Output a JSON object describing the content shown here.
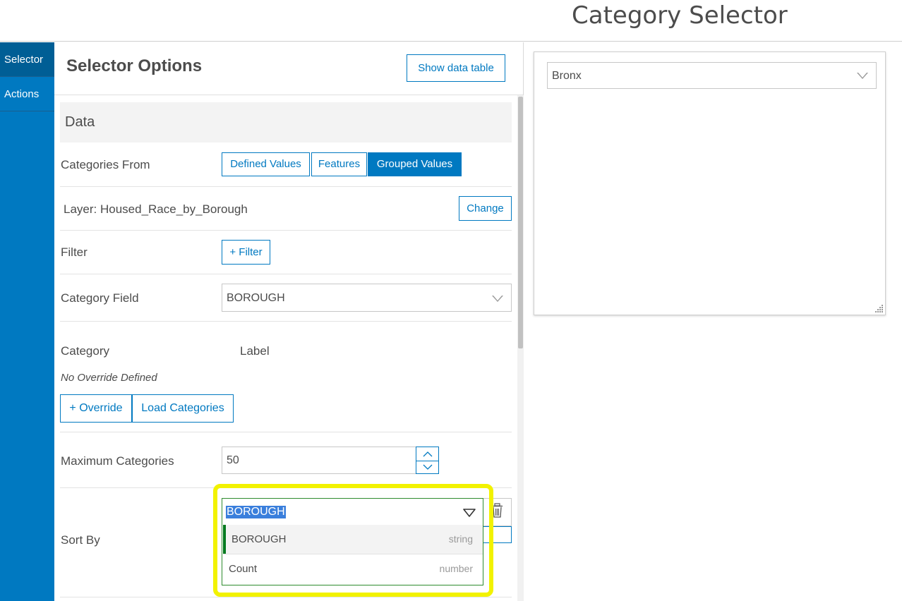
{
  "header": {
    "title": "Category Selector"
  },
  "rail": {
    "tabs": [
      {
        "label": "Selector"
      },
      {
        "label": "Actions"
      }
    ]
  },
  "panel": {
    "title": "Selector Options",
    "show_table_label": "Show data table",
    "data_section": {
      "title": "Data"
    },
    "categories_from": {
      "label": "Categories From",
      "options": [
        "Defined Values",
        "Features",
        "Grouped Values"
      ],
      "selected": "Grouped Values"
    },
    "layer": {
      "label": "Layer: Housed_Race_by_Borough",
      "change_label": "Change"
    },
    "filter": {
      "label": "Filter",
      "button_label": "+ Filter"
    },
    "category_field": {
      "label": "Category Field",
      "value": "BOROUGH"
    },
    "override": {
      "category_header": "Category",
      "label_header": "Label",
      "empty_text": "No Override Defined",
      "add_label": "+ Override",
      "load_label": "Load Categories"
    },
    "max_categories": {
      "label": "Maximum Categories",
      "value": "50"
    },
    "sort_by": {
      "label": "Sort By",
      "value": "BOROUGH",
      "options": [
        {
          "name": "BOROUGH",
          "type": "string"
        },
        {
          "name": "Count",
          "type": "number"
        }
      ]
    }
  },
  "preview": {
    "selected": "Bronx"
  },
  "colors": {
    "accent": "#0079c1",
    "highlight": "#f2f200",
    "active_option_bar": "#007a1e"
  },
  "icons": [
    "chevron-down-icon",
    "chevron-up-icon",
    "trash-icon",
    "resize-grip-icon"
  ]
}
